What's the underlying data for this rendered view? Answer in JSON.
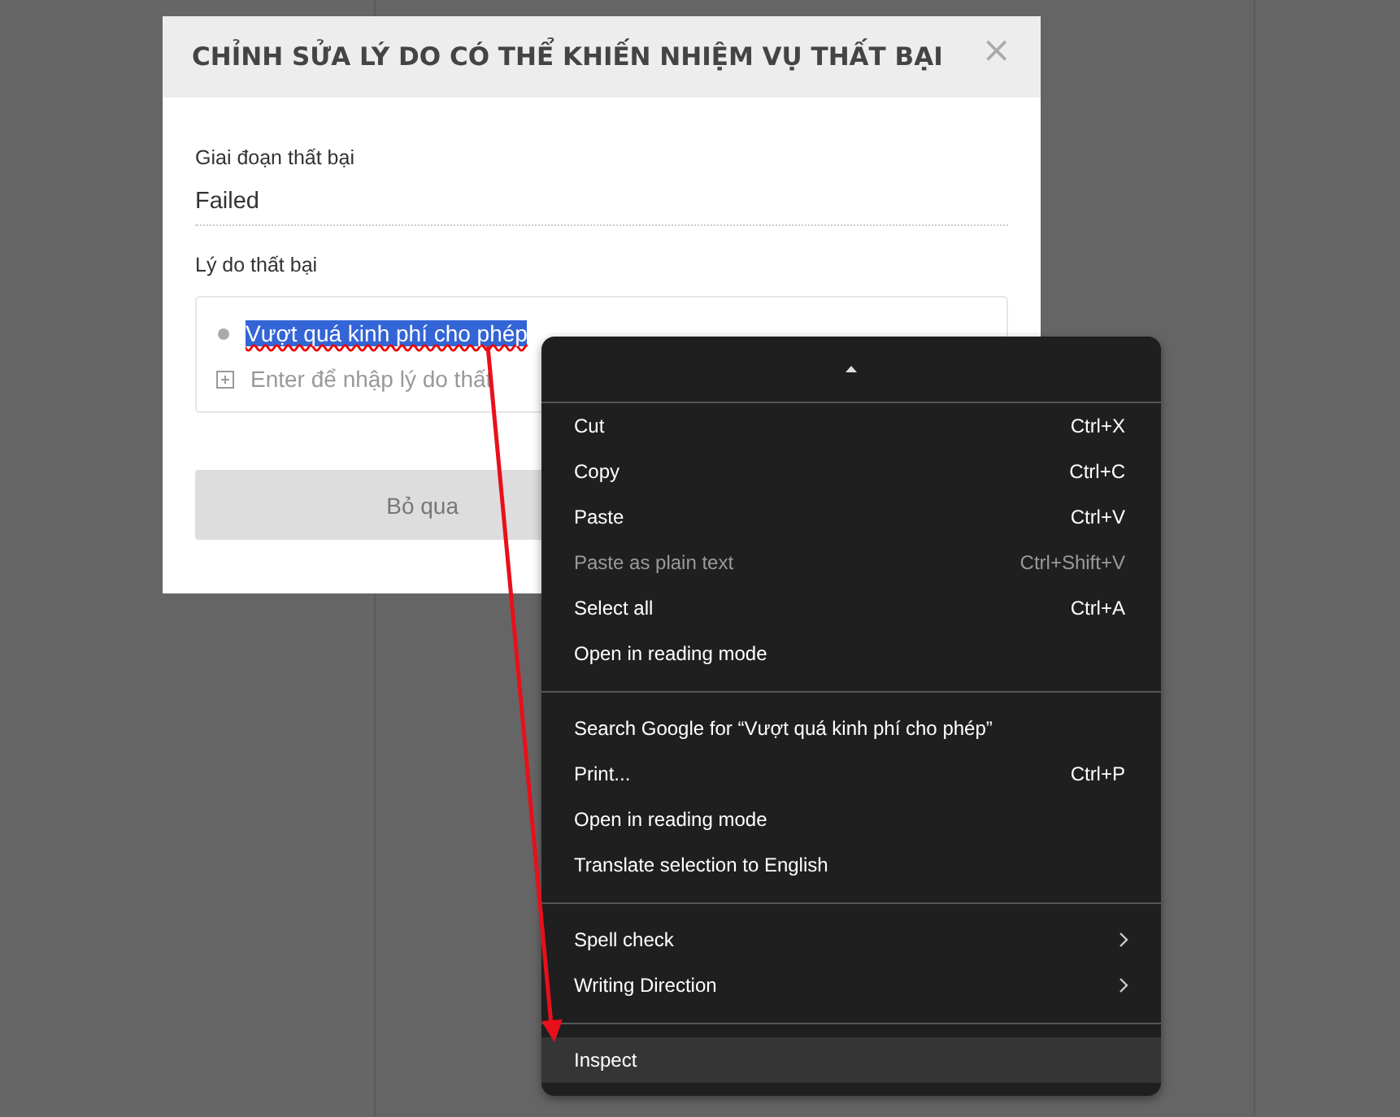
{
  "dialog": {
    "title": "CHỈNH SỬA LÝ DO CÓ THỂ KHIẾN NHIỆM VỤ THẤT BẠI",
    "close": "×",
    "stage_label": "Giai đoạn thất bại",
    "stage_value": "Failed",
    "reasons_label": "Lý do thất bại",
    "reasons": [
      {
        "text": "Vượt quá kinh phí cho phép",
        "selected": true,
        "misspelled": true
      }
    ],
    "new_reason": {
      "placeholder": "Enter để nhập lý do thất"
    },
    "buttons": [
      "Bỏ qua"
    ]
  },
  "context_menu": {
    "items": [
      {
        "kind": "scroll-up"
      },
      {
        "kind": "separator"
      },
      {
        "kind": "item",
        "label": "Cut",
        "shortcut": "Ctrl+X",
        "disabled": false,
        "selected": false
      },
      {
        "kind": "item",
        "label": "Copy",
        "shortcut": "Ctrl+C",
        "disabled": false,
        "selected": false
      },
      {
        "kind": "item",
        "label": "Paste",
        "shortcut": "Ctrl+V",
        "disabled": false,
        "selected": false
      },
      {
        "kind": "item",
        "label": "Paste as plain text",
        "shortcut": "Ctrl+Shift+V",
        "disabled": true,
        "selected": false
      },
      {
        "kind": "item",
        "label": "Select all",
        "shortcut": "Ctrl+A",
        "disabled": false,
        "selected": false
      },
      {
        "kind": "item",
        "label": "Open in reading mode",
        "disabled": false,
        "selected": false
      },
      {
        "kind": "separator"
      },
      {
        "kind": "item",
        "label": "Search Google for “Vượt quá kinh phí cho phép”",
        "disabled": false,
        "selected": false
      },
      {
        "kind": "item",
        "label": "Print...",
        "shortcut": "Ctrl+P",
        "disabled": false,
        "selected": false
      },
      {
        "kind": "item",
        "label": "Open in reading mode",
        "disabled": false,
        "selected": false
      },
      {
        "kind": "item",
        "label": "Translate selection to English",
        "disabled": false,
        "selected": false
      },
      {
        "kind": "separator"
      },
      {
        "kind": "submenu",
        "label": "Spell check",
        "disabled": false,
        "selected": false
      },
      {
        "kind": "submenu",
        "label": "Writing Direction",
        "disabled": false,
        "selected": false
      },
      {
        "kind": "separator"
      },
      {
        "kind": "item",
        "label": "Inspect",
        "disabled": false,
        "selected": true
      }
    ]
  }
}
